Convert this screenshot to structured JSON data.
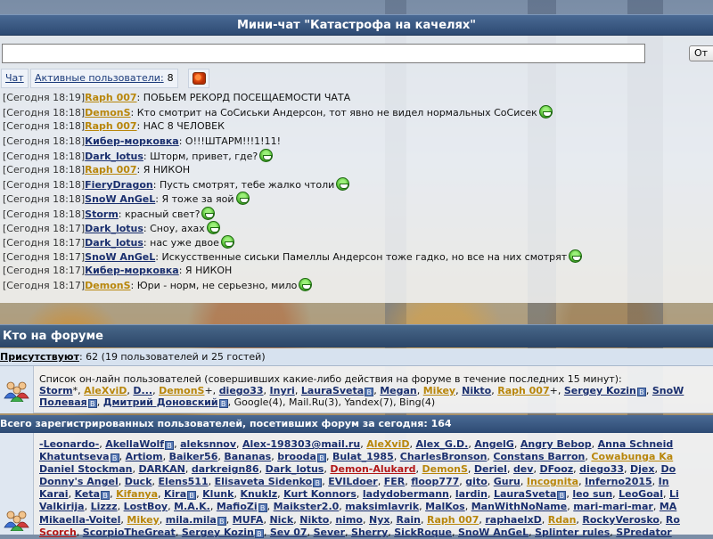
{
  "chat": {
    "title": "Мини-чат \"Катастрофа на качелях\"",
    "input_value": "",
    "send_label": "От",
    "tab_chat": "Чат",
    "tab_users": "Активные пользователи:",
    "users_count": "8",
    "messages": [
      {
        "time": "[Сегодня 18:19]",
        "nick": "Raph 007",
        "gold": true,
        "text": ": ПОБЬЕМ РЕКОРД ПОСЕЩАЕМОСТИ ЧАТА",
        "smiley": false
      },
      {
        "time": "[Сегодня 18:18]",
        "nick": "DemonS",
        "gold": true,
        "text": ": Кто смотрит на СоСиськи Андерсон, тот явно не видел нормальных СоСисек",
        "smiley": true
      },
      {
        "time": "[Сегодня 18:18]",
        "nick": "Raph 007",
        "gold": true,
        "text": ": НАС 8 ЧЕЛОВЕК",
        "smiley": false
      },
      {
        "time": "[Сегодня 18:18]",
        "nick": "Кибер-морковка",
        "gold": false,
        "text": ": О!!!ШТАРМ!!!1!11!",
        "smiley": false
      },
      {
        "time": "[Сегодня 18:18]",
        "nick": "Dark_lotus",
        "gold": false,
        "text": ": Шторм, привет, где?",
        "smiley": true
      },
      {
        "time": "[Сегодня 18:18]",
        "nick": "Raph 007",
        "gold": true,
        "text": ": Я НИКОН",
        "smiley": false
      },
      {
        "time": "[Сегодня 18:18]",
        "nick": "FieryDragon",
        "gold": false,
        "text": ": Пусть смотрят, тебе жалко чтоли",
        "smiley": true
      },
      {
        "time": "[Сегодня 18:18]",
        "nick": "SnoW AnGeL",
        "gold": false,
        "text": ": Я тоже за яой",
        "smiley": true
      },
      {
        "time": "[Сегодня 18:18]",
        "nick": "Storm",
        "gold": false,
        "text": ": красный свет?",
        "smiley": true
      },
      {
        "time": "[Сегодня 18:17]",
        "nick": "Dark_lotus",
        "gold": false,
        "text": ": Сноу, ахах",
        "smiley": true
      },
      {
        "time": "[Сегодня 18:17]",
        "nick": "Dark_lotus",
        "gold": false,
        "text": ": нас уже двое",
        "smiley": true
      },
      {
        "time": "[Сегодня 18:17]",
        "nick": "SnoW AnGeL",
        "gold": false,
        "text": ": Искусственные сиськи Памеллы Андерсон тоже гадко, но все на них смотрят",
        "smiley": true
      },
      {
        "time": "[Сегодня 18:17]",
        "nick": "Кибер-морковка",
        "gold": false,
        "text": ": Я НИКОН",
        "smiley": false
      },
      {
        "time": "[Сегодня 18:17]",
        "nick": "DemonS",
        "gold": true,
        "text": ": Юри - норм, не серьезно, мило",
        "smiley": true
      }
    ]
  },
  "forum": {
    "title": "Кто на форуме",
    "present_label": "Присутствуют",
    "present_value": ": 62 (19 пользователей и 25 гостей)",
    "online_desc": "Список он-лайн пользователей (совершивших какие-либо действия на форуме в течение последних 15 минут):",
    "online_line1": [
      {
        "n": "Storm",
        "s": "*, "
      },
      {
        "n": "AleXviD",
        "gold": true,
        "s": ", "
      },
      {
        "n": "D...",
        "s": ", "
      },
      {
        "n": "DemonS",
        "gold": true,
        "s": "+, "
      },
      {
        "n": "diego33",
        "s": ", "
      },
      {
        "n": "Inyri",
        "s": ", "
      },
      {
        "n": "LauraSveta",
        "b": true,
        "s": ", "
      },
      {
        "n": "Megan",
        "s": ", "
      },
      {
        "n": "Mikey",
        "gold": true,
        "s": ", "
      },
      {
        "n": "Nikto",
        "s": ", "
      },
      {
        "n": "Raph 007",
        "gold": true,
        "s": "+, "
      },
      {
        "n": "Sergey Kozin",
        "b": true,
        "s": ", "
      },
      {
        "n": "SnoW",
        "s": ""
      }
    ],
    "online_line2": [
      {
        "n": "Полевая",
        "b": true,
        "s": ", "
      },
      {
        "n": "Дмитрий Доновский",
        "b": true,
        "s": ", Google(4), Mail.Ru(3), Yandex(7), Bing(4)"
      }
    ],
    "total_label": "Всего зарегистрированных пользователей, посетивших форум за сегодня: 164",
    "today_lines": [
      [
        {
          "n": "-Leonardo-"
        },
        {
          "n": "AkellaWolf",
          "b": true
        },
        {
          "n": "aleksnnov"
        },
        {
          "n": "Alex-198303@mail.ru"
        },
        {
          "n": "AleXviD",
          "gold": true
        },
        {
          "n": "Alex_G.D."
        },
        {
          "n": "AngelG"
        },
        {
          "n": "Angry Bebop"
        },
        {
          "n": "Anna Schneid"
        }
      ],
      [
        {
          "n": "Khatuntseva",
          "b": true
        },
        {
          "n": "Artiom"
        },
        {
          "n": "Baiker56"
        },
        {
          "n": "Bananas"
        },
        {
          "n": "brooda",
          "b": true
        },
        {
          "n": "Bulat_1985"
        },
        {
          "n": "CharlesBronson"
        },
        {
          "n": "Constans Barron"
        },
        {
          "n": "Cowabunga Ka",
          "gold": true
        }
      ],
      [
        {
          "n": "Daniel Stockman"
        },
        {
          "n": "DARKAN"
        },
        {
          "n": "darkreign86"
        },
        {
          "n": "Dark_lotus"
        },
        {
          "n": "Demon-Alukard",
          "red": true
        },
        {
          "n": "DemonS",
          "gold": true
        },
        {
          "n": "Deriel"
        },
        {
          "n": "dev"
        },
        {
          "n": "DFooz"
        },
        {
          "n": "diego33"
        },
        {
          "n": "Djex"
        },
        {
          "n": "Do"
        }
      ],
      [
        {
          "n": "Donny's Angel"
        },
        {
          "n": "Duck"
        },
        {
          "n": "Elens511"
        },
        {
          "n": "Elisaveta Sidenko",
          "b": true
        },
        {
          "n": "EVILdoer"
        },
        {
          "n": "FER"
        },
        {
          "n": "floop777"
        },
        {
          "n": "gito"
        },
        {
          "n": "Guru"
        },
        {
          "n": "Incognita",
          "gold": true
        },
        {
          "n": "Inferno2015"
        },
        {
          "n": "In"
        }
      ],
      [
        {
          "n": "Karai"
        },
        {
          "n": "Keta",
          "b": true
        },
        {
          "n": "Kifanya",
          "gold": true
        },
        {
          "n": "Kira",
          "b": true
        },
        {
          "n": "Klunk"
        },
        {
          "n": "Knuklz"
        },
        {
          "n": "Kurt Konnors"
        },
        {
          "n": "ladydobermann"
        },
        {
          "n": "lardin"
        },
        {
          "n": "LauraSveta",
          "b": true
        },
        {
          "n": "leo sun"
        },
        {
          "n": "LeoGoal"
        },
        {
          "n": "Li"
        }
      ],
      [
        {
          "n": "Valkirija"
        },
        {
          "n": "Lizzz"
        },
        {
          "n": "LostBoy"
        },
        {
          "n": "M.A.K."
        },
        {
          "n": "MafioZi",
          "b": true
        },
        {
          "n": "Maikster2.0"
        },
        {
          "n": "maksimlavrik"
        },
        {
          "n": "MalKos"
        },
        {
          "n": "ManWithNoName"
        },
        {
          "n": "mari-mari-mar"
        },
        {
          "n": "MA"
        }
      ],
      [
        {
          "n": "Mikaella-Voitel"
        },
        {
          "n": "Mikey",
          "gold": true
        },
        {
          "n": "mila.mila",
          "b": true
        },
        {
          "n": "MUFA"
        },
        {
          "n": "Nick"
        },
        {
          "n": "Nikto"
        },
        {
          "n": "nimo"
        },
        {
          "n": "Nyx"
        },
        {
          "n": "Rain"
        },
        {
          "n": "Raph 007",
          "gold": true
        },
        {
          "n": "raphaelxD"
        },
        {
          "n": "Rdan",
          "gold": true
        },
        {
          "n": "RockyVerosko"
        },
        {
          "n": "Ro"
        }
      ],
      [
        {
          "n": "Scorch",
          "red": true
        },
        {
          "n": "ScorpioTheGreat"
        },
        {
          "n": "Sergey Kozin",
          "b": true
        },
        {
          "n": "Sev 07"
        },
        {
          "n": "Sever"
        },
        {
          "n": "Sherry"
        },
        {
          "n": "SickRoque"
        },
        {
          "n": "SnoW AnGeL"
        },
        {
          "n": "Splinter rules"
        },
        {
          "n": "SPredator"
        }
      ]
    ]
  },
  "icons": {
    "refresh": "refresh-icon",
    "smiley": "smiley-icon",
    "users": "users-group-icon",
    "badge": "blog-badge-icon"
  }
}
